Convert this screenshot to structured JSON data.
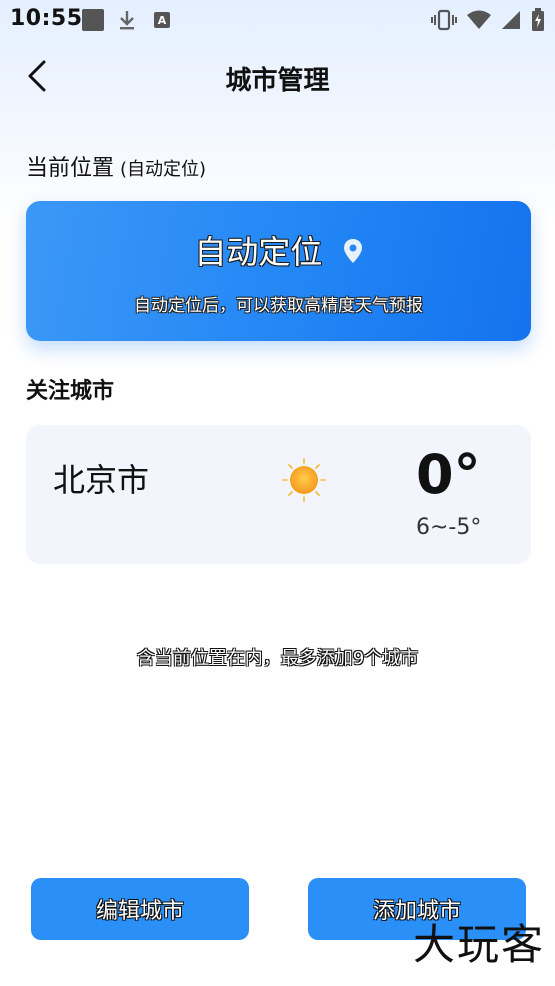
{
  "statusbar": {
    "time": "10:55",
    "icons_left": [
      "app-square-icon",
      "download-icon",
      "a-notification-icon"
    ],
    "icons_right": [
      "vibrate-icon",
      "wifi-icon",
      "signal-icon",
      "battery-charging-icon"
    ],
    "a_letter": "A"
  },
  "header": {
    "title": "城市管理",
    "back_icon": "chevron-left-icon"
  },
  "current_location": {
    "section_label": "当前位置",
    "section_sub": "(自动定位)",
    "card_title": "自动定位",
    "card_desc": "自动定位后，可以获取高精度天气预报",
    "pin_icon": "location-pin-icon"
  },
  "followed": {
    "section_label": "关注城市",
    "cities": [
      {
        "name": "北京市",
        "weather_icon": "sun-icon",
        "temp": "0°",
        "range": "6~-5°"
      }
    ]
  },
  "limit_note": "含当前位置在内，最多添加9个城市",
  "buttons": {
    "edit": "编辑城市",
    "add": "添加城市"
  },
  "watermark": "大玩客",
  "colors": {
    "primary": "#2a8ff7",
    "card_bg": "#f2f5fb",
    "sun": "#f5a524"
  }
}
